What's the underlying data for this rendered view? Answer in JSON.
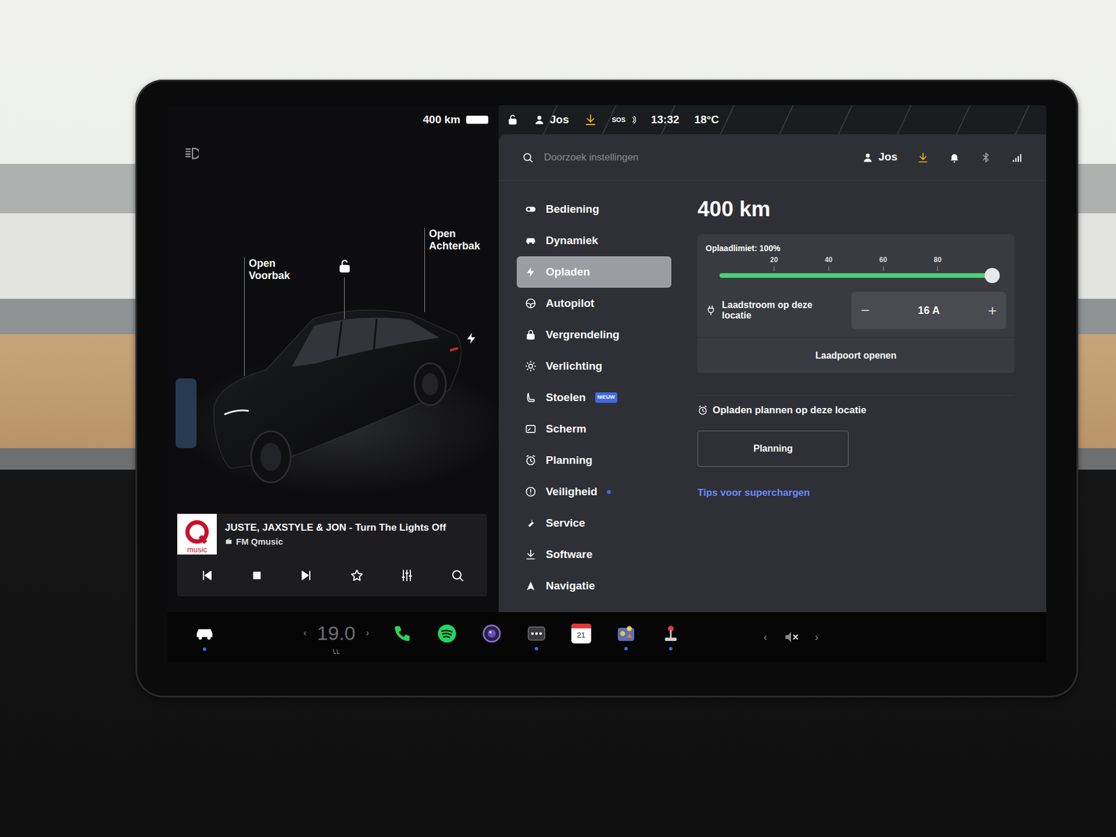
{
  "status_bar": {
    "range": "400 km",
    "battery_level": 1,
    "locked": false,
    "user": "Jos",
    "sos": "SOS",
    "time": "13:32",
    "temperature": "18°C"
  },
  "car_view": {
    "frunk": "Open Voorbak",
    "trunk": "Open Achterbak",
    "locked": false,
    "charging": true
  },
  "media": {
    "logo": "music",
    "title": "JUSTE, JAXSTYLE & JON - Turn The Lights Off",
    "source": "FM Qmusic",
    "favorite": false
  },
  "settings": {
    "search": {
      "placeholder": "Doorzoek instellingen"
    },
    "user": "Jos",
    "menu": [
      {
        "label": "Bediening",
        "kind": "toggle",
        "selected": false
      },
      {
        "label": "Dynamiek",
        "kind": "car",
        "selected": false
      },
      {
        "label": "Opladen",
        "kind": "bolt",
        "selected": true
      },
      {
        "label": "Autopilot",
        "kind": "wheel",
        "selected": false
      },
      {
        "label": "Vergrendeling",
        "kind": "lock",
        "selected": false
      },
      {
        "label": "Verlichting",
        "kind": "sun",
        "selected": false
      },
      {
        "label": "Stoelen",
        "kind": "seat",
        "selected": false,
        "badge": "NIEUW"
      },
      {
        "label": "Scherm",
        "kind": "screen",
        "selected": false
      },
      {
        "label": "Planning",
        "kind": "alarm",
        "selected": false
      },
      {
        "label": "Veiligheid",
        "kind": "info",
        "selected": false,
        "dot": true
      },
      {
        "label": "Service",
        "kind": "wrench",
        "selected": false
      },
      {
        "label": "Software",
        "kind": "download",
        "selected": false
      },
      {
        "label": "Navigatie",
        "kind": "nav",
        "selected": false
      }
    ],
    "panel": {
      "range": "400 km",
      "charge_limit": {
        "label": "Oplaadlimiet: 100%",
        "ticks": [
          "20",
          "40",
          "60",
          "80"
        ],
        "level": 1
      },
      "current": {
        "label": "Laadstroom op deze locatie",
        "value": "16 A",
        "minus": "−",
        "plus": "+"
      },
      "open_port": "Laadpoort openen",
      "schedule_title": "Opladen plannen op deze locatie",
      "schedule_button": "Planning",
      "tips_link": "Tips voor superchargen"
    }
  },
  "dock": {
    "car": {
      "active": true
    },
    "climate": {
      "left": "‹",
      "value": "19.0",
      "right": "›"
    },
    "apps": [
      {
        "kind": "phone",
        "active": false
      },
      {
        "kind": "spotify",
        "active": false
      },
      {
        "kind": "camera",
        "active": false
      },
      {
        "kind": "more",
        "active": true
      },
      {
        "kind": "calendar",
        "label": "21",
        "active": false
      },
      {
        "kind": "games",
        "active": true
      },
      {
        "kind": "joystick",
        "active": true
      }
    ],
    "volume": {
      "left": "‹",
      "muted": true,
      "right": "›"
    }
  }
}
